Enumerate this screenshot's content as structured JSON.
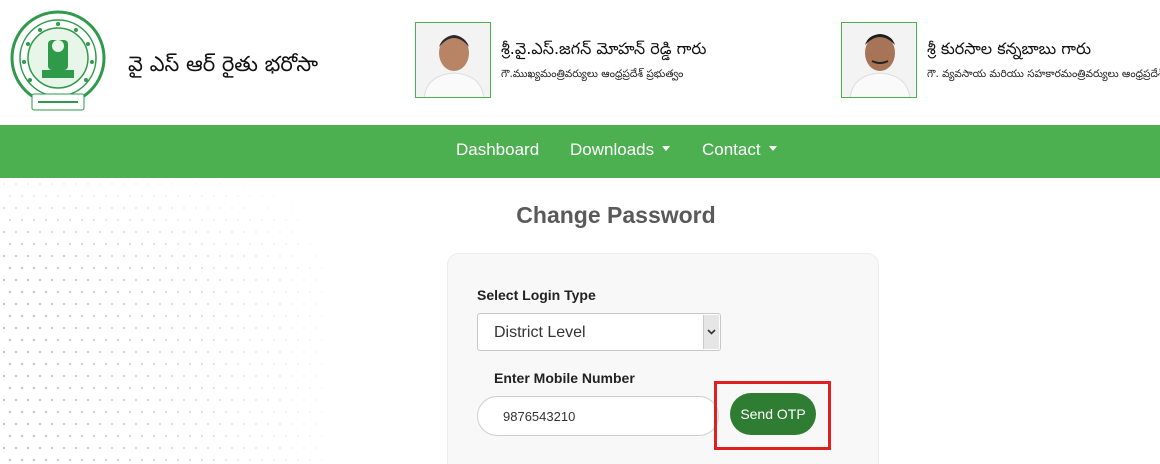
{
  "header": {
    "site_title": "వై ఎస్ ఆర్ రైతు భరోసా",
    "people": [
      {
        "name": "శ్రీ.వై.ఎస్.జగన్ మోహన్ రెడ్డి గారు",
        "role": "గౌ.ముఖ్యమంత్రివర్యులు ఆంధ్రప్రదేశ్ ప్రభుత్వం"
      },
      {
        "name": "శ్రీ కురసాల కన్నబాబు గారు",
        "role": "గౌ. వ్యవసాయ మరియు సహకారమంత్రివర్యులు ఆంధ్రప్రదేశ్"
      }
    ]
  },
  "nav": {
    "items": [
      {
        "label": "Dashboard"
      },
      {
        "label": "Downloads"
      },
      {
        "label": "Contact"
      }
    ]
  },
  "main": {
    "title": "Change Password",
    "login_type_label": "Select Login Type",
    "login_type_value": "District Level",
    "mobile_label": "Enter Mobile Number",
    "mobile_value": "9876543210",
    "send_otp_label": "Send OTP"
  },
  "colors": {
    "nav_green": "#4caf50",
    "button_green": "#2e7d32",
    "highlight_red": "#e02020"
  }
}
